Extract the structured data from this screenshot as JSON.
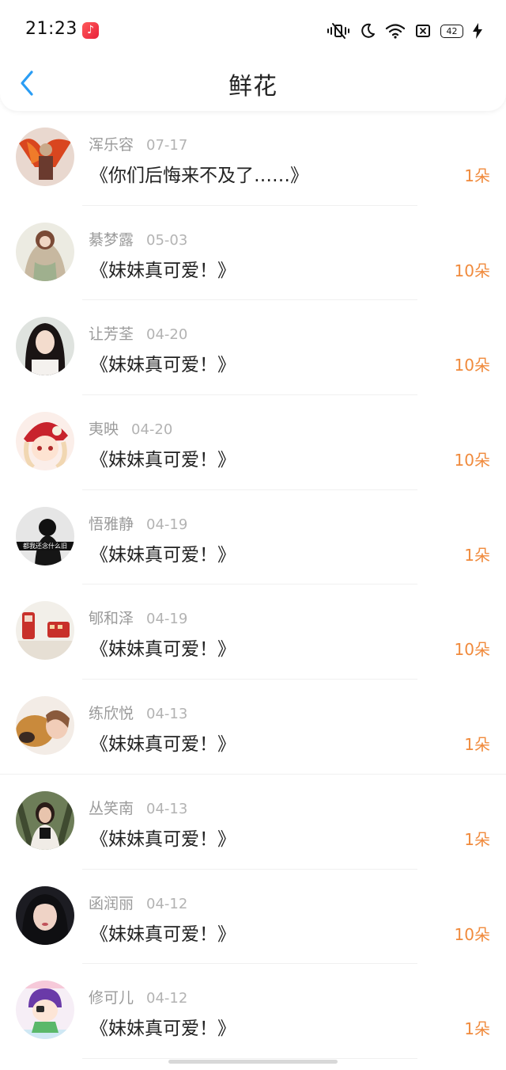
{
  "status_bar": {
    "time": "21:23",
    "battery": "42",
    "icons": [
      "music-app-icon",
      "vibrate-mute-icon",
      "moon-icon",
      "wifi-icon",
      "sim-off-icon",
      "battery-icon",
      "charging-icon"
    ]
  },
  "header": {
    "title": "鲜花",
    "back_icon": "chevron-left-icon"
  },
  "accent_color": "#f08a3c",
  "list": [
    {
      "name": "浑乐容",
      "date": "07-17",
      "message": "《你们后悔来不及了……》",
      "count": "1朵"
    },
    {
      "name": "綦梦露",
      "date": "05-03",
      "message": "《妹妹真可爱！》",
      "count": "10朵"
    },
    {
      "name": "让芳荃",
      "date": "04-20",
      "message": "《妹妹真可爱！》",
      "count": "10朵"
    },
    {
      "name": "夷映",
      "date": "04-20",
      "message": "《妹妹真可爱！》",
      "count": "10朵"
    },
    {
      "name": "悟雅静",
      "date": "04-19",
      "message": "《妹妹真可爱！》",
      "count": "1朵",
      "avatar_caption": "都我还念什么旧"
    },
    {
      "name": "郇和泽",
      "date": "04-19",
      "message": "《妹妹真可爱！》",
      "count": "10朵"
    },
    {
      "name": "练欣悦",
      "date": "04-13",
      "message": "《妹妹真可爱！》",
      "count": "1朵"
    },
    {
      "name": "丛笑南",
      "date": "04-13",
      "message": "《妹妹真可爱！》",
      "count": "1朵"
    },
    {
      "name": "函润丽",
      "date": "04-12",
      "message": "《妹妹真可爱！》",
      "count": "10朵"
    },
    {
      "name": "修可儿",
      "date": "04-12",
      "message": "《妹妹真可爱！》",
      "count": "1朵"
    }
  ]
}
